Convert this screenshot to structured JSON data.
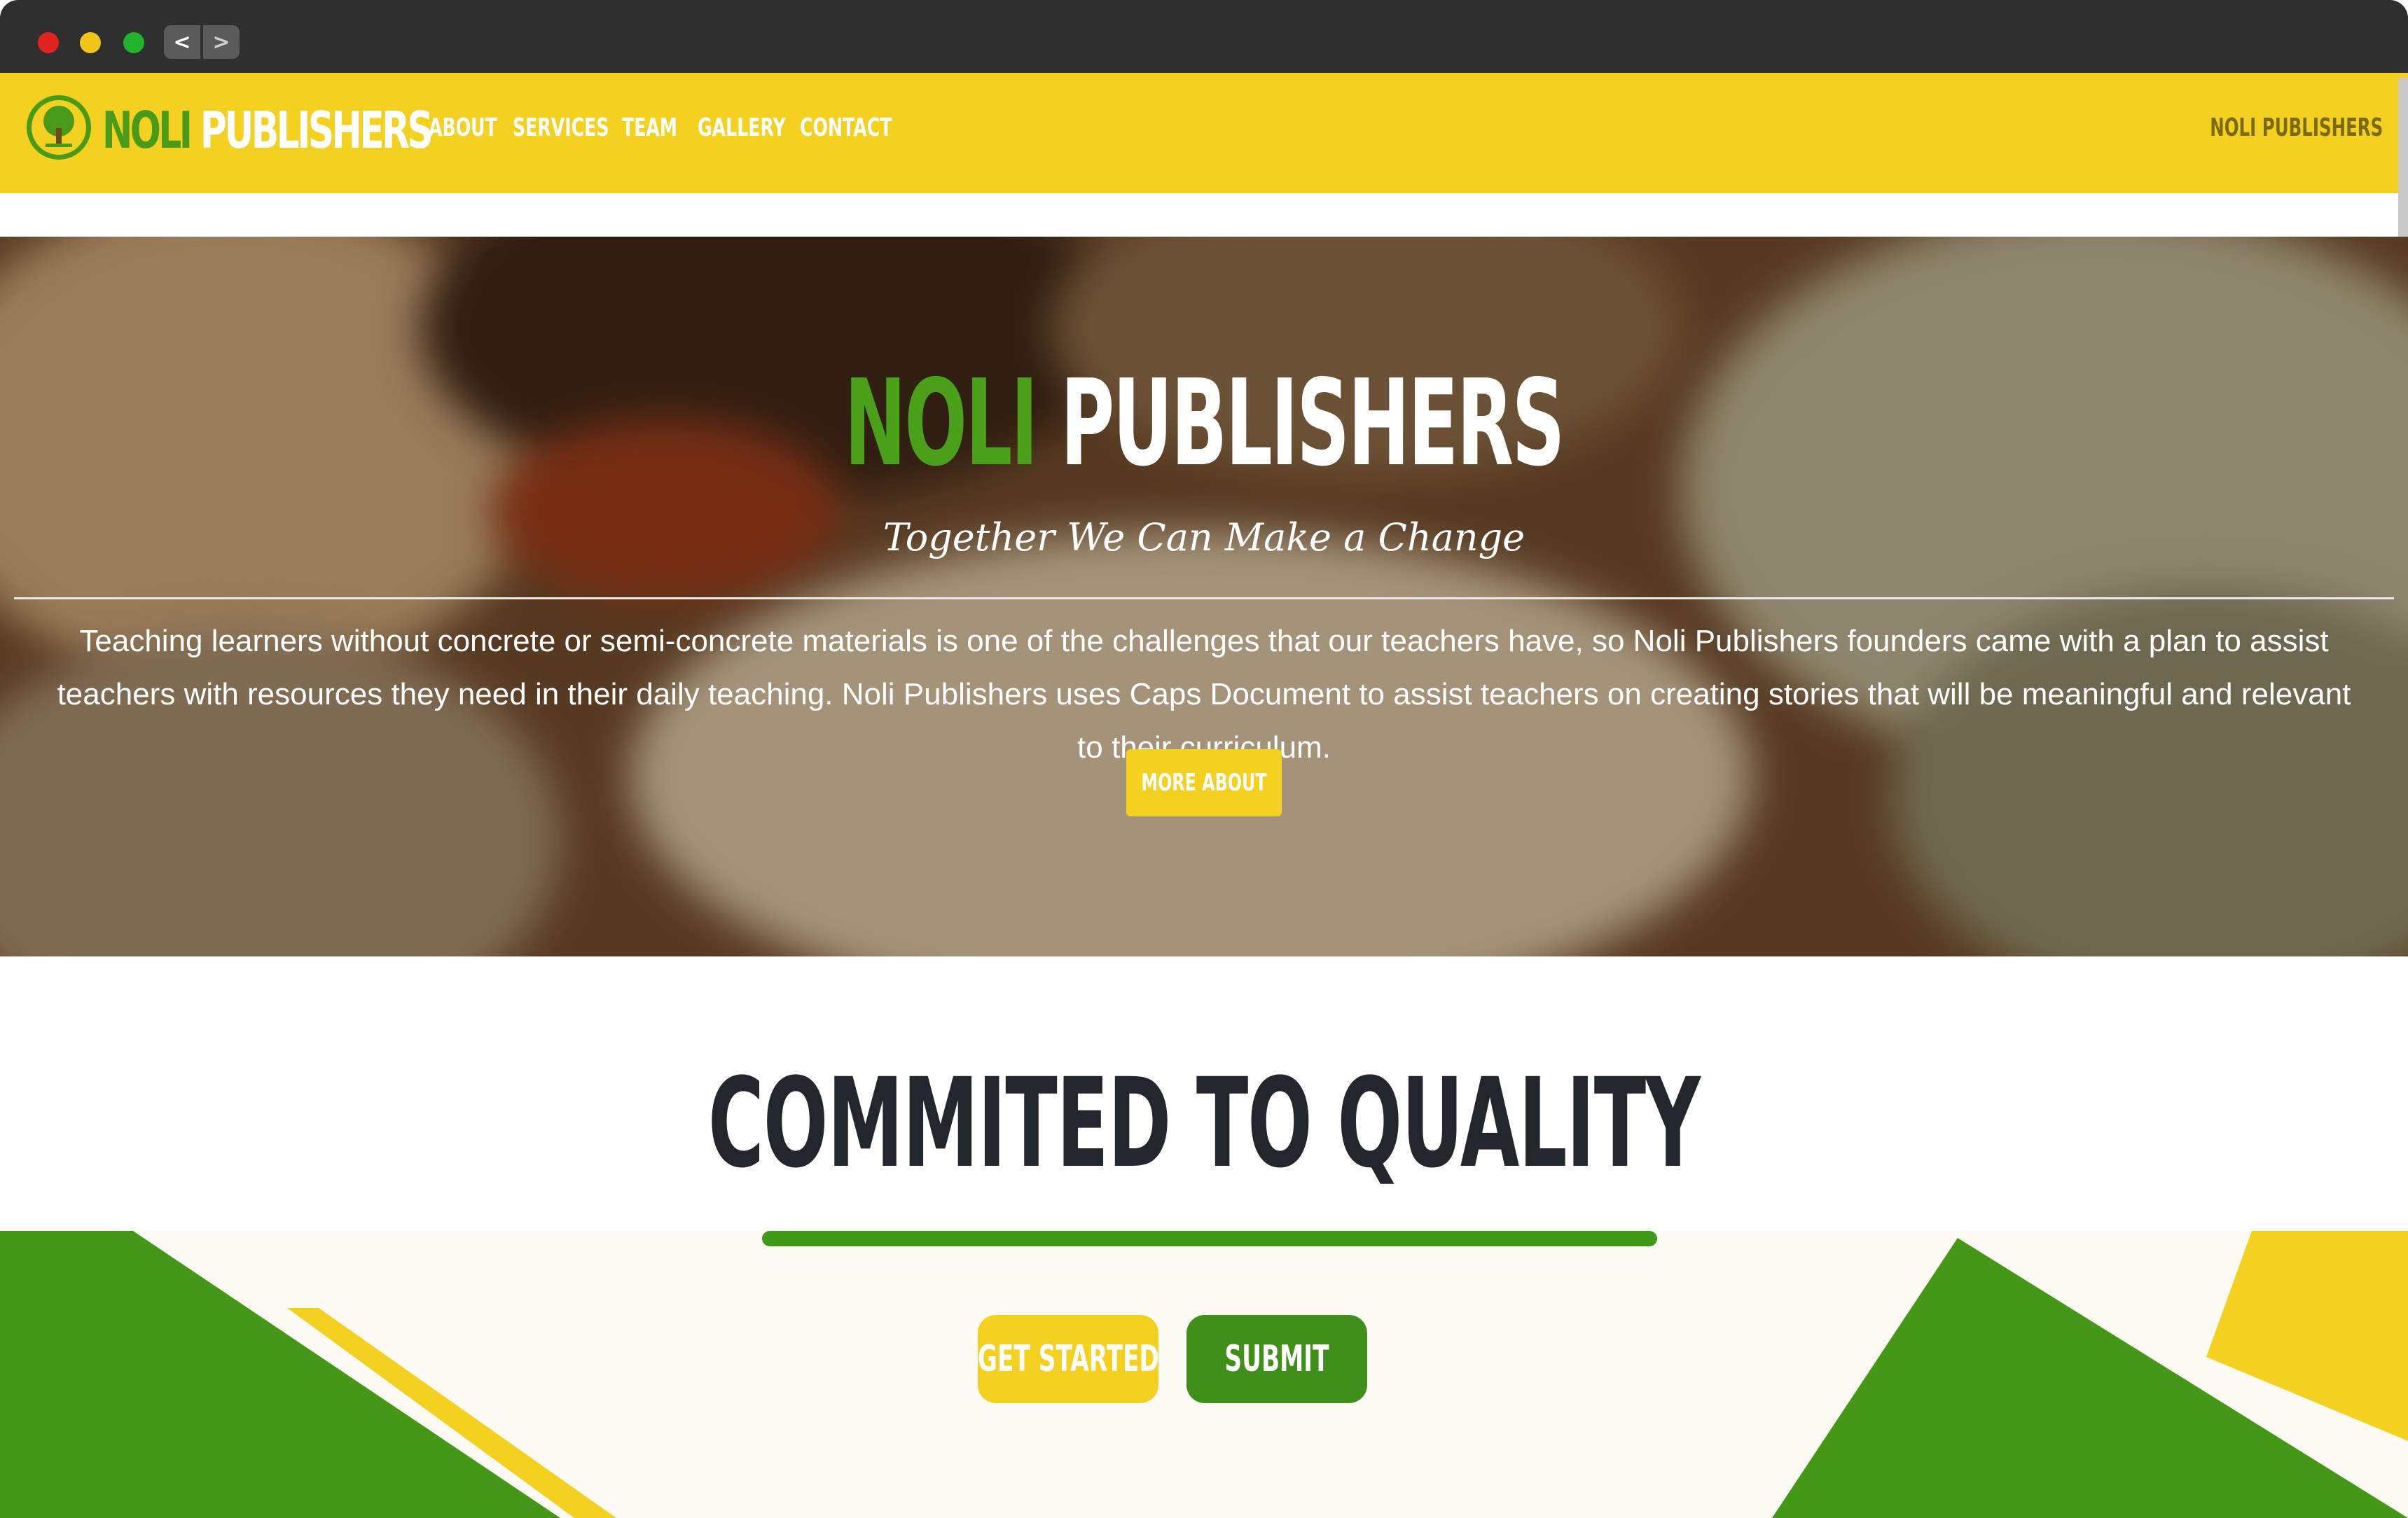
{
  "browser": {
    "back_label": "<",
    "forward_label": ">"
  },
  "header": {
    "brand_first": "NOLI",
    "brand_second": "PUBLISHERS",
    "nav": [
      "ABOUT",
      "SERVICES",
      "TEAM",
      "GALLERY",
      "CONTACT"
    ],
    "right_label": "NOLI PUBLISHERS",
    "logo_icon": "tree-icon"
  },
  "hero": {
    "title_first": "NOLI",
    "title_second": "PUBLISHERS",
    "tagline": "Together We Can Make a Change",
    "description": "Teaching learners without concrete or semi-concrete materials is one of the challenges that our teachers have, so Noli Publishers founders came with a plan to assist teachers with resources they need in their daily teaching. Noli Publishers uses Caps Document to assist teachers on creating stories that will be meaningful and relevant to their curriculum.",
    "button_label": "MORE ABOUT"
  },
  "section": {
    "heading": "COMMITED TO QUALITY",
    "get_started_label": "GET STARTED",
    "submit_label": "SUBMIT"
  },
  "colors": {
    "brand_yellow": "#f4d120",
    "brand_green": "#3f9a1a",
    "heading_dark": "#23262d"
  }
}
